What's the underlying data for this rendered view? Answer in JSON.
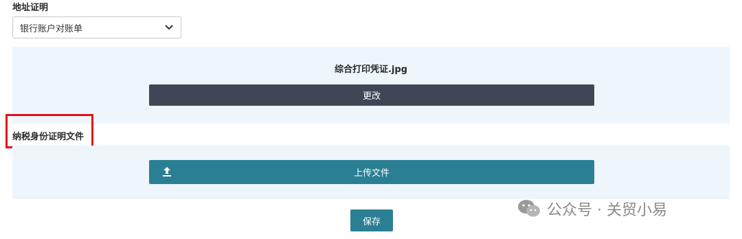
{
  "address_proof": {
    "label": "地址证明",
    "selected_option": "银行账户对账单",
    "icon": "chevron-down-icon"
  },
  "uploaded_file": {
    "file_name": "综合打印凭证.jpg",
    "change_button_label": "更改"
  },
  "tax_id_proof": {
    "label": "纳税身份证明文件",
    "upload_button_label": "上传文件",
    "upload_icon": "upload-icon"
  },
  "save_button_label": "保存",
  "watermark": {
    "text": "公众号 · 关贸小易"
  },
  "colors": {
    "panel_bg": "#eef6fc",
    "change_button_bg": "#3f4756",
    "primary": "#2b7f94",
    "highlight_border": "#e3101c"
  }
}
